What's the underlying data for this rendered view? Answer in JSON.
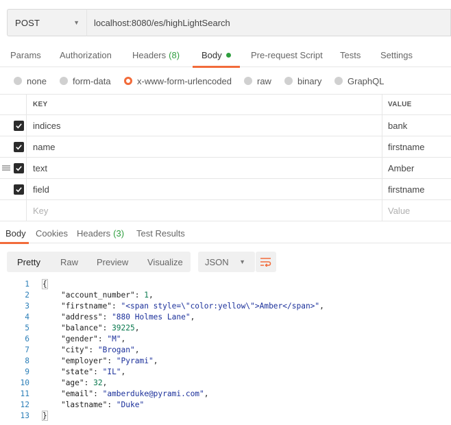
{
  "request": {
    "method": "POST",
    "url": "localhost:8080/es/highLightSearch"
  },
  "request_tabs": [
    {
      "label": "Params"
    },
    {
      "label": "Authorization"
    },
    {
      "label": "Headers",
      "count": "(8)"
    },
    {
      "label": "Body"
    },
    {
      "label": "Pre-request Script"
    },
    {
      "label": "Tests"
    },
    {
      "label": "Settings"
    }
  ],
  "body_types": [
    {
      "label": "none"
    },
    {
      "label": "form-data"
    },
    {
      "label": "x-www-form-urlencoded"
    },
    {
      "label": "raw"
    },
    {
      "label": "binary"
    },
    {
      "label": "GraphQL"
    }
  ],
  "table": {
    "key_header": "KEY",
    "value_header": "VALUE",
    "rows": [
      {
        "key": "indices",
        "value": "bank"
      },
      {
        "key": "name",
        "value": "firstname"
      },
      {
        "key": "text",
        "value": "Amber"
      },
      {
        "key": "field",
        "value": "firstname"
      }
    ],
    "key_placeholder": "Key",
    "value_placeholder": "Value"
  },
  "response_tabs": [
    {
      "label": "Body"
    },
    {
      "label": "Cookies"
    },
    {
      "label": "Headers",
      "count": "(3)"
    },
    {
      "label": "Test Results"
    }
  ],
  "view_modes": [
    "Pretty",
    "Raw",
    "Preview",
    "Visualize"
  ],
  "format": "JSON",
  "code_lines": [
    {
      "n": "1",
      "open": "{"
    },
    {
      "n": "2",
      "key": "\"account_number\"",
      "val": "1",
      "type": "num",
      "comma": ","
    },
    {
      "n": "3",
      "key": "\"firstname\"",
      "val": "\"<span style=\\\"color:yellow\\\">Amber</span>\"",
      "type": "str",
      "comma": ","
    },
    {
      "n": "4",
      "key": "\"address\"",
      "val": "\"880 Holmes Lane\"",
      "type": "str",
      "comma": ","
    },
    {
      "n": "5",
      "key": "\"balance\"",
      "val": "39225",
      "type": "num",
      "comma": ","
    },
    {
      "n": "6",
      "key": "\"gender\"",
      "val": "\"M\"",
      "type": "str",
      "comma": ","
    },
    {
      "n": "7",
      "key": "\"city\"",
      "val": "\"Brogan\"",
      "type": "str",
      "comma": ","
    },
    {
      "n": "8",
      "key": "\"employer\"",
      "val": "\"Pyrami\"",
      "type": "str",
      "comma": ","
    },
    {
      "n": "9",
      "key": "\"state\"",
      "val": "\"IL\"",
      "type": "str",
      "comma": ","
    },
    {
      "n": "10",
      "key": "\"age\"",
      "val": "32",
      "type": "num",
      "comma": ","
    },
    {
      "n": "11",
      "key": "\"email\"",
      "val": "\"amberduke@pyrami.com\"",
      "type": "str",
      "comma": ","
    },
    {
      "n": "12",
      "key": "\"lastname\"",
      "val": "\"Duke\"",
      "type": "str",
      "comma": ""
    },
    {
      "n": "13",
      "open": "}"
    }
  ],
  "colors": {
    "accent": "#f26b3a",
    "success": "#2e9e3e",
    "line_number": "#2c7fb8",
    "json_string": "#1a2f9a",
    "json_number": "#0b7a4f"
  }
}
